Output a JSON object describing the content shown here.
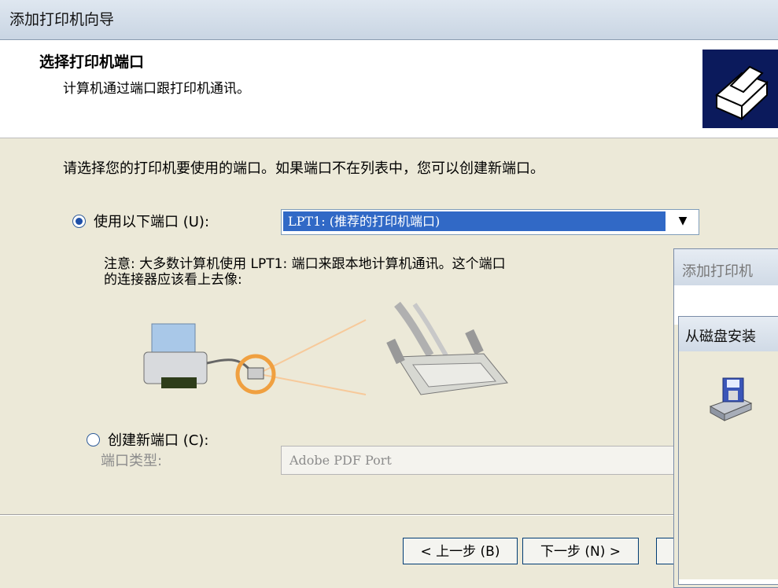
{
  "window": {
    "title": "添加打印机向导"
  },
  "header": {
    "title": "选择打印机端口",
    "subtitle": "计算机通过端口跟打印机通讯。",
    "icon": "printer-wizard-icon"
  },
  "instruction": "请选择您的打印机要使用的端口。如果端口不在列表中，您可以创建新端口。",
  "use_port": {
    "label": "使用以下端口 (U):",
    "selected": true,
    "selected_value": "LPT1:  (推荐的打印机端口)"
  },
  "note": {
    "line1": "注意: 大多数计算机使用 LPT1: 端口来跟本地计算机通讯。这个端口",
    "line2": "的连接器应该看上去像:"
  },
  "create_port": {
    "label": "创建新端口 (C):",
    "selected": false,
    "type_label": "端口类型:",
    "type_value": "Adobe PDF Port"
  },
  "buttons": {
    "back": "< 上一步 (B)",
    "next": "下一步 (N) >"
  },
  "overlay_dialog_1": {
    "title": "添加打印机"
  },
  "overlay_dialog_2": {
    "title": "从磁盘安装"
  },
  "colors": {
    "selection": "#3169c6",
    "header_icon_bg": "#0b1a5c"
  }
}
